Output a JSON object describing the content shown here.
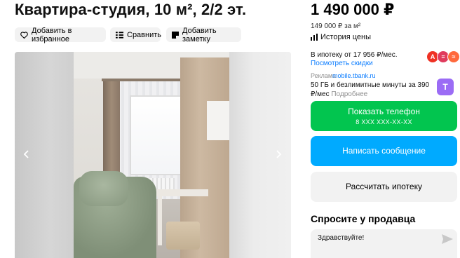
{
  "listing": {
    "title": "Квартира-студия, 10 м², 2/2 эт."
  },
  "actions": {
    "favorite": "Добавить в избранное",
    "compare": "Сравнить",
    "note": "Добавить заметку"
  },
  "gallery": {
    "photo_subject": "studio room with window, sofa and shelving"
  },
  "price": {
    "amount": "1 490 000 ₽",
    "per_meter": "149 000 ₽ за м²",
    "history": "История цены"
  },
  "mortgage": {
    "text": "В ипотеку от 17 956 ₽/мес.",
    "link": "Посмотреть скидки"
  },
  "ad": {
    "label": "Реклама",
    "link": "mobile.tbank.ru",
    "text": "50 ГБ и безлимитные минуты за 390 ₽/мес",
    "more": "Подробнее"
  },
  "buttons": {
    "phone_label": "Показать телефон",
    "phone_number": "8 XXX XXX-XX-XX",
    "message": "Написать сообщение",
    "mortgage_calc": "Рассчитать ипотеку"
  },
  "seller": {
    "ask_title": "Спросите у продавца",
    "greeting": "Здравствуйте!"
  },
  "colors": {
    "green": "#02c54f",
    "blue": "#00aaff",
    "link": "#0a7cff",
    "bank_alfa": "#ef3124",
    "bank_sber_like": "#e03b5d",
    "bank_tbank_ad": "#9b6cf5"
  },
  "icons": [
    "heart-icon",
    "compare-icon",
    "note-icon",
    "chart-icon",
    "arrow-left-icon",
    "arrow-right-icon",
    "send-icon"
  ]
}
